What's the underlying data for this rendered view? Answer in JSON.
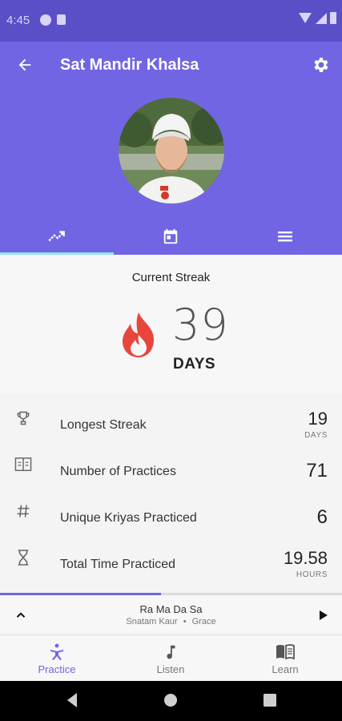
{
  "status_bar": {
    "time": "4:45"
  },
  "header": {
    "title": "Sat Mandir Khalsa",
    "accent_color": "#7265e3",
    "tab_indicator_color": "#8fe3f0"
  },
  "tabs": [
    {
      "icon": "trending-up-icon",
      "active": true
    },
    {
      "icon": "calendar-icon",
      "active": false
    },
    {
      "icon": "list-icon",
      "active": false
    }
  ],
  "streak": {
    "label": "Current Streak",
    "value": "39",
    "unit": "DAYS",
    "flame_color": "#e8453c"
  },
  "stats": [
    {
      "icon": "trophy-icon",
      "label": "Longest Streak",
      "value": "19",
      "unit": "DAYS"
    },
    {
      "icon": "book-counter-icon",
      "label": "Number of Practices",
      "value": "71",
      "unit": ""
    },
    {
      "icon": "hash-icon",
      "label": "Unique Kriyas Practiced",
      "value": "6",
      "unit": ""
    },
    {
      "icon": "hourglass-icon",
      "label": "Total Time Practiced",
      "value": "19.58",
      "unit": "HOURS"
    }
  ],
  "player": {
    "title": "Ra Ma Da Sa",
    "artist": "Snatam Kaur",
    "separator": "•",
    "album": "Grace",
    "progress": 0.47
  },
  "bottom_nav": [
    {
      "label": "Practice",
      "icon": "meditation-icon",
      "active": true
    },
    {
      "label": "Listen",
      "icon": "music-note-icon",
      "active": false
    },
    {
      "label": "Learn",
      "icon": "book-icon",
      "active": false
    }
  ]
}
